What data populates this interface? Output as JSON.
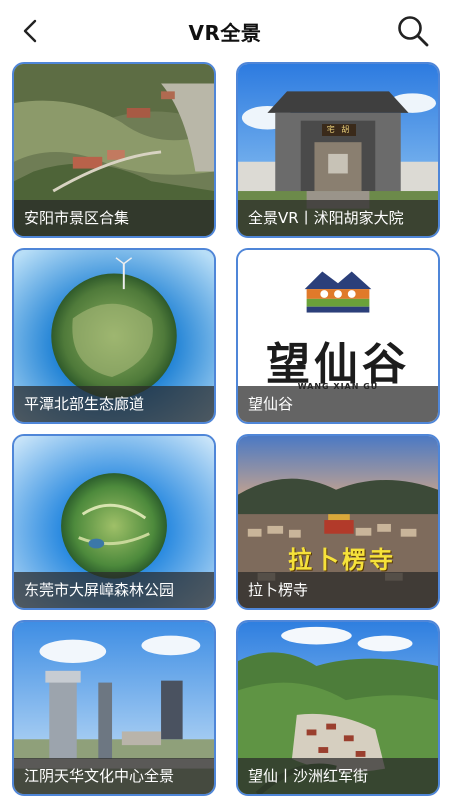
{
  "header": {
    "title": "VR全景"
  },
  "items": [
    {
      "caption": "安阳市景区合集"
    },
    {
      "caption": "全景VR丨沭阳胡家大院"
    },
    {
      "caption": "平潭北部生态廊道"
    },
    {
      "caption": "望仙谷",
      "logo_text": "望仙谷",
      "logo_sub": "WANG XIAN GU"
    },
    {
      "caption": "东莞市大屏嶂森林公园"
    },
    {
      "caption": "拉卜楞寺",
      "banner": "拉卜楞寺"
    },
    {
      "caption": "江阴天华文化中心全景"
    },
    {
      "caption": "望仙丨沙洲红军街"
    }
  ],
  "colors": {
    "card_border": "#4f86d8",
    "caption_bg": "rgba(40,40,40,0.72)"
  }
}
